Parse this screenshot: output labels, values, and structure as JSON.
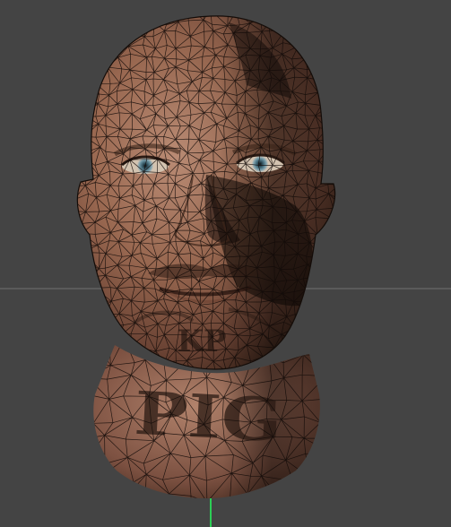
{
  "viewport": {
    "background_color": "#444444",
    "grid_line_color": "#5a5a5a",
    "axis_y_color": "#2ccf55"
  },
  "model": {
    "skin_base_color": "#8a5a45",
    "skin_highlight_color": "#b98a70",
    "shadow_color": "#1e1410",
    "wireframe_color": "#120b08",
    "eye_color": "#4f7585",
    "neck_tattoo": "PIG",
    "chin_tattoo": "KP"
  }
}
